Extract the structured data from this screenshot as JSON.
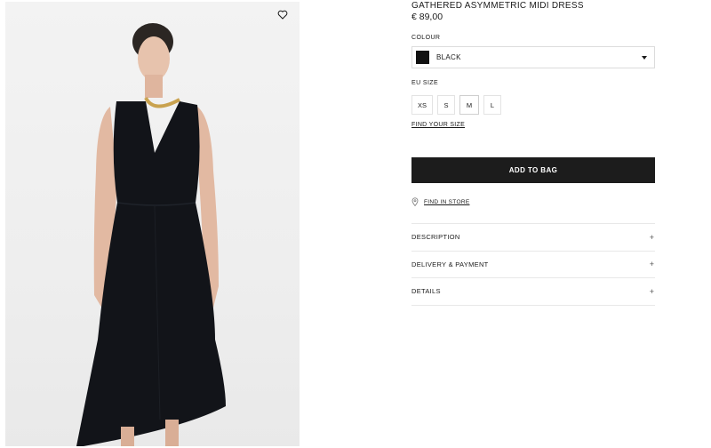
{
  "product": {
    "title": "GATHERED ASYMMETRIC MIDI DRESS",
    "price": "€ 89,00"
  },
  "colour": {
    "label": "COLOUR",
    "selected": "BLACK",
    "swatch_color": "#111111"
  },
  "size": {
    "label": "EU SIZE",
    "options": [
      "XS",
      "S",
      "M",
      "L"
    ],
    "find_size_link": "FIND YOUR SIZE"
  },
  "actions": {
    "add_to_bag": "ADD TO BAG",
    "find_in_store": "FIND IN STORE"
  },
  "accordion": [
    {
      "label": "DESCRIPTION",
      "icon": "+"
    },
    {
      "label": "DELIVERY & PAYMENT",
      "icon": "+"
    },
    {
      "label": "DETAILS",
      "icon": "+"
    }
  ],
  "icons": {
    "wishlist": "heart-icon",
    "store": "location-pin-icon",
    "dropdown": "chevron-down-icon"
  }
}
